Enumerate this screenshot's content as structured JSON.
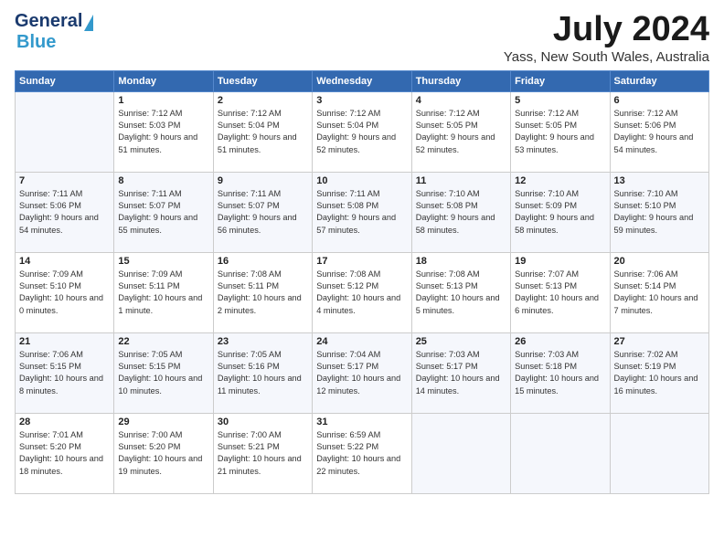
{
  "header": {
    "logo_line1": "General",
    "logo_line2": "Blue",
    "month": "July 2024",
    "location": "Yass, New South Wales, Australia"
  },
  "days_of_week": [
    "Sunday",
    "Monday",
    "Tuesday",
    "Wednesday",
    "Thursday",
    "Friday",
    "Saturday"
  ],
  "weeks": [
    [
      {
        "day": "",
        "empty": true
      },
      {
        "day": "1",
        "sunrise": "7:12 AM",
        "sunset": "5:03 PM",
        "daylight": "9 hours and 51 minutes."
      },
      {
        "day": "2",
        "sunrise": "7:12 AM",
        "sunset": "5:04 PM",
        "daylight": "9 hours and 51 minutes."
      },
      {
        "day": "3",
        "sunrise": "7:12 AM",
        "sunset": "5:04 PM",
        "daylight": "9 hours and 52 minutes."
      },
      {
        "day": "4",
        "sunrise": "7:12 AM",
        "sunset": "5:05 PM",
        "daylight": "9 hours and 52 minutes."
      },
      {
        "day": "5",
        "sunrise": "7:12 AM",
        "sunset": "5:05 PM",
        "daylight": "9 hours and 53 minutes."
      },
      {
        "day": "6",
        "sunrise": "7:12 AM",
        "sunset": "5:06 PM",
        "daylight": "9 hours and 54 minutes."
      }
    ],
    [
      {
        "day": "7",
        "sunrise": "7:11 AM",
        "sunset": "5:06 PM",
        "daylight": "9 hours and 54 minutes."
      },
      {
        "day": "8",
        "sunrise": "7:11 AM",
        "sunset": "5:07 PM",
        "daylight": "9 hours and 55 minutes."
      },
      {
        "day": "9",
        "sunrise": "7:11 AM",
        "sunset": "5:07 PM",
        "daylight": "9 hours and 56 minutes."
      },
      {
        "day": "10",
        "sunrise": "7:11 AM",
        "sunset": "5:08 PM",
        "daylight": "9 hours and 57 minutes."
      },
      {
        "day": "11",
        "sunrise": "7:10 AM",
        "sunset": "5:08 PM",
        "daylight": "9 hours and 58 minutes."
      },
      {
        "day": "12",
        "sunrise": "7:10 AM",
        "sunset": "5:09 PM",
        "daylight": "9 hours and 58 minutes."
      },
      {
        "day": "13",
        "sunrise": "7:10 AM",
        "sunset": "5:10 PM",
        "daylight": "9 hours and 59 minutes."
      }
    ],
    [
      {
        "day": "14",
        "sunrise": "7:09 AM",
        "sunset": "5:10 PM",
        "daylight": "10 hours and 0 minutes."
      },
      {
        "day": "15",
        "sunrise": "7:09 AM",
        "sunset": "5:11 PM",
        "daylight": "10 hours and 1 minute."
      },
      {
        "day": "16",
        "sunrise": "7:08 AM",
        "sunset": "5:11 PM",
        "daylight": "10 hours and 2 minutes."
      },
      {
        "day": "17",
        "sunrise": "7:08 AM",
        "sunset": "5:12 PM",
        "daylight": "10 hours and 4 minutes."
      },
      {
        "day": "18",
        "sunrise": "7:08 AM",
        "sunset": "5:13 PM",
        "daylight": "10 hours and 5 minutes."
      },
      {
        "day": "19",
        "sunrise": "7:07 AM",
        "sunset": "5:13 PM",
        "daylight": "10 hours and 6 minutes."
      },
      {
        "day": "20",
        "sunrise": "7:06 AM",
        "sunset": "5:14 PM",
        "daylight": "10 hours and 7 minutes."
      }
    ],
    [
      {
        "day": "21",
        "sunrise": "7:06 AM",
        "sunset": "5:15 PM",
        "daylight": "10 hours and 8 minutes."
      },
      {
        "day": "22",
        "sunrise": "7:05 AM",
        "sunset": "5:15 PM",
        "daylight": "10 hours and 10 minutes."
      },
      {
        "day": "23",
        "sunrise": "7:05 AM",
        "sunset": "5:16 PM",
        "daylight": "10 hours and 11 minutes."
      },
      {
        "day": "24",
        "sunrise": "7:04 AM",
        "sunset": "5:17 PM",
        "daylight": "10 hours and 12 minutes."
      },
      {
        "day": "25",
        "sunrise": "7:03 AM",
        "sunset": "5:17 PM",
        "daylight": "10 hours and 14 minutes."
      },
      {
        "day": "26",
        "sunrise": "7:03 AM",
        "sunset": "5:18 PM",
        "daylight": "10 hours and 15 minutes."
      },
      {
        "day": "27",
        "sunrise": "7:02 AM",
        "sunset": "5:19 PM",
        "daylight": "10 hours and 16 minutes."
      }
    ],
    [
      {
        "day": "28",
        "sunrise": "7:01 AM",
        "sunset": "5:20 PM",
        "daylight": "10 hours and 18 minutes."
      },
      {
        "day": "29",
        "sunrise": "7:00 AM",
        "sunset": "5:20 PM",
        "daylight": "10 hours and 19 minutes."
      },
      {
        "day": "30",
        "sunrise": "7:00 AM",
        "sunset": "5:21 PM",
        "daylight": "10 hours and 21 minutes."
      },
      {
        "day": "31",
        "sunrise": "6:59 AM",
        "sunset": "5:22 PM",
        "daylight": "10 hours and 22 minutes."
      },
      {
        "day": "",
        "empty": true
      },
      {
        "day": "",
        "empty": true
      },
      {
        "day": "",
        "empty": true
      }
    ]
  ],
  "labels": {
    "sunrise": "Sunrise:",
    "sunset": "Sunset:",
    "daylight": "Daylight:"
  }
}
